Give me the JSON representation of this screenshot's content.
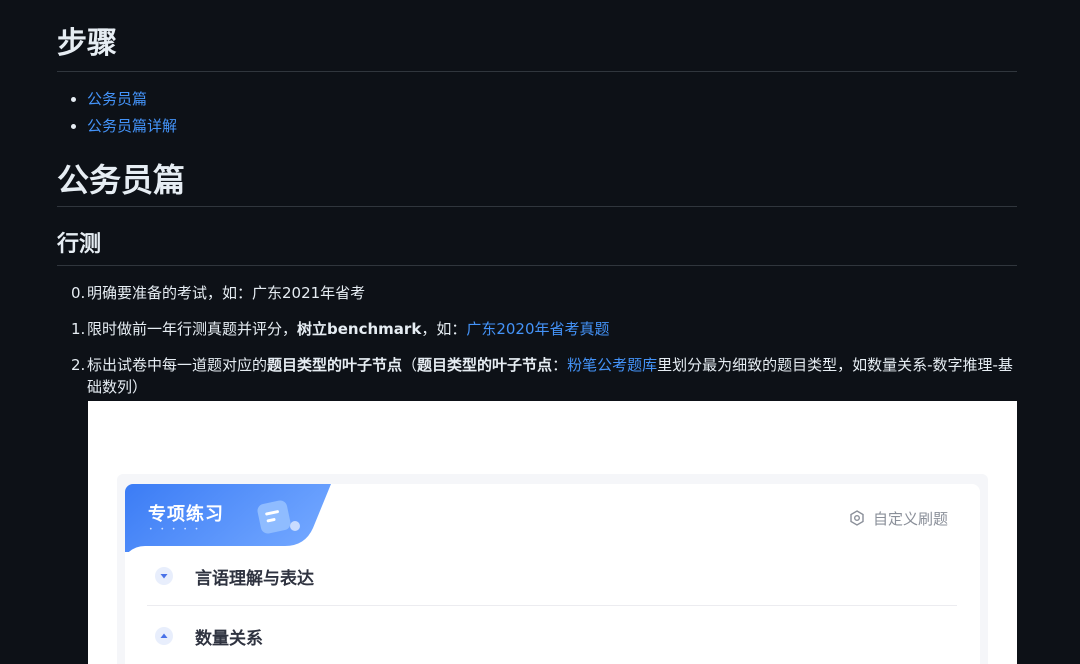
{
  "headings": {
    "steps": "步骤",
    "civil": "公务员篇",
    "xingce": "行测"
  },
  "toc": {
    "items": [
      {
        "label": "公务员篇"
      },
      {
        "label": "公务员篇详解"
      }
    ]
  },
  "steps": [
    {
      "num": "0.",
      "text": "明确要准备的考试，如：广东2021年省考"
    },
    {
      "num": "1.",
      "text_a": "限时做前一年行测真题并评分，",
      "bold": "树立benchmark",
      "text_b": "，如：",
      "link": "广东2020年省考真题"
    },
    {
      "num": "2.",
      "text_a": "标出试卷中每一道题对应的",
      "bold_a": "题目类型的叶子节点",
      "text_b": "（",
      "bold_b": "题目类型的叶子节点",
      "text_c": "：",
      "link": "粉笔公考题库",
      "text_d": "里划分最为细致的题目类型，如数量关系-数字推理-基础数列）"
    }
  ],
  "screenshot": {
    "card_title": "专项练习",
    "card_dots": "• • • • •",
    "custom_label": "自定义刷题",
    "rows": [
      {
        "label": "言语理解与表达",
        "state": "collapsed"
      },
      {
        "label": "数量关系",
        "state": "expanded"
      }
    ],
    "colors": {
      "accent": "#3b7cf5",
      "chevron": "#4a72e8"
    }
  }
}
